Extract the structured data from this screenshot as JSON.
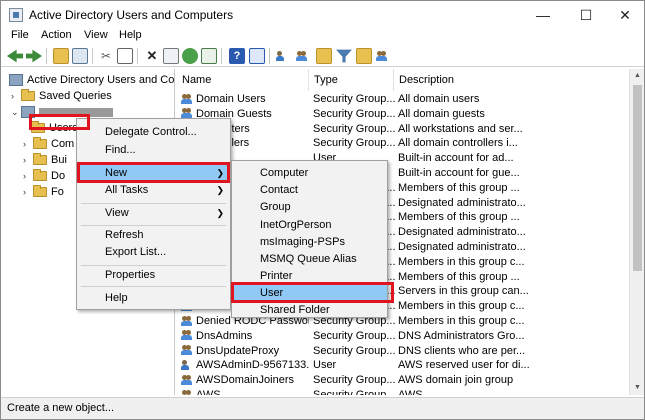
{
  "window": {
    "title": "Active Directory Users and Computers"
  },
  "titlebar_controls": {
    "minimize": "—",
    "maximize": "☐",
    "close": "✕"
  },
  "menubar": [
    "File",
    "Action",
    "View",
    "Help"
  ],
  "toolbar_icons": [
    "back-icon",
    "forward-icon",
    "up-folder-icon",
    "console-tree-icon",
    "cut-icon",
    "copy-icon",
    "delete-icon",
    "properties-icon",
    "refresh-icon",
    "export-icon",
    "help-icon",
    "console-icon",
    "new-user-icon",
    "new-group-icon",
    "new-ou-icon",
    "filter-icon",
    "find-icon",
    "add-to-group-icon"
  ],
  "tree": {
    "root": "Active Directory Users and Com",
    "saved_queries": "Saved Queries",
    "children": [
      "Users",
      "Com",
      "Bui",
      "Do",
      "Fo"
    ]
  },
  "list": {
    "columns": [
      "Name",
      "Type",
      "Description"
    ],
    "rows": [
      {
        "name": "Domain Users",
        "type": "Security Group...",
        "desc": "All domain users",
        "icon": "group"
      },
      {
        "name": "Domain Guests",
        "type": "Security Group...",
        "desc": "All domain guests",
        "icon": "group"
      },
      {
        "name": "Computers",
        "type": "Security Group...",
        "desc": "All workstations and ser...",
        "icon": "group"
      },
      {
        "name": "Controllers",
        "type": "Security Group...",
        "desc": "All domain controllers i...",
        "icon": "group"
      },
      {
        "name": "rator",
        "type": "User",
        "desc": "Built-in account for ad...",
        "icon": "user"
      },
      {
        "name": "",
        "type": "User",
        "desc": "Built-in account for gue...",
        "icon": "user"
      },
      {
        "name": "",
        "type": "Security Group...",
        "desc": "Members of this group ...",
        "icon": "group"
      },
      {
        "name": "",
        "type": "Security Group...",
        "desc": "Designated administrato...",
        "icon": "group"
      },
      {
        "name": "",
        "type": "Security Group...",
        "desc": "Members of this group ...",
        "icon": "group"
      },
      {
        "name": "",
        "type": "Security Group...",
        "desc": "Designated administrato...",
        "icon": "group"
      },
      {
        "name": "",
        "type": "Security Group...",
        "desc": "Designated administrato...",
        "icon": "group"
      },
      {
        "name": "",
        "type": "Security Group...",
        "desc": "Members in this group c...",
        "icon": "group"
      },
      {
        "name": "",
        "type": "Security Group...",
        "desc": "Members of this group ...",
        "icon": "group"
      },
      {
        "name": "",
        "type": "Security Group...",
        "desc": "Servers in this group can...",
        "icon": "group"
      },
      {
        "name": "Allowed...",
        "type": "Security Group...",
        "desc": "Members in this group c...",
        "icon": "group"
      },
      {
        "name": "Denied RODC Passwor...",
        "type": "Security Group...",
        "desc": "Members in this group c...",
        "icon": "group"
      },
      {
        "name": "DnsAdmins",
        "type": "Security Group...",
        "desc": "DNS Administrators Gro...",
        "icon": "group"
      },
      {
        "name": "DnsUpdateProxy",
        "type": "Security Group...",
        "desc": "DNS clients who are per...",
        "icon": "group"
      },
      {
        "name": "AWSAdminD-9567133...",
        "type": "User",
        "desc": "AWS reserved user for di...",
        "icon": "user"
      },
      {
        "name": "AWSDomainJoiners",
        "type": "Security Group...",
        "desc": "AWS domain join group",
        "icon": "group"
      },
      {
        "name": "AWS...",
        "type": "Security Group...",
        "desc": "AWS ...",
        "icon": "group"
      }
    ]
  },
  "context_menu": {
    "items": [
      "Delegate Control...",
      "Find...",
      "New",
      "All Tasks",
      "View",
      "Refresh",
      "Export List...",
      "Properties",
      "Help"
    ]
  },
  "new_submenu": {
    "items": [
      "Computer",
      "Contact",
      "Group",
      "InetOrgPerson",
      "msImaging-PSPs",
      "MSMQ Queue Alias",
      "Printer",
      "User",
      "Shared Folder"
    ]
  },
  "status": {
    "text": "Create a new object..."
  },
  "colors": {
    "highlight_red": "#e0141e",
    "menu_hover": "#90c8f6"
  }
}
